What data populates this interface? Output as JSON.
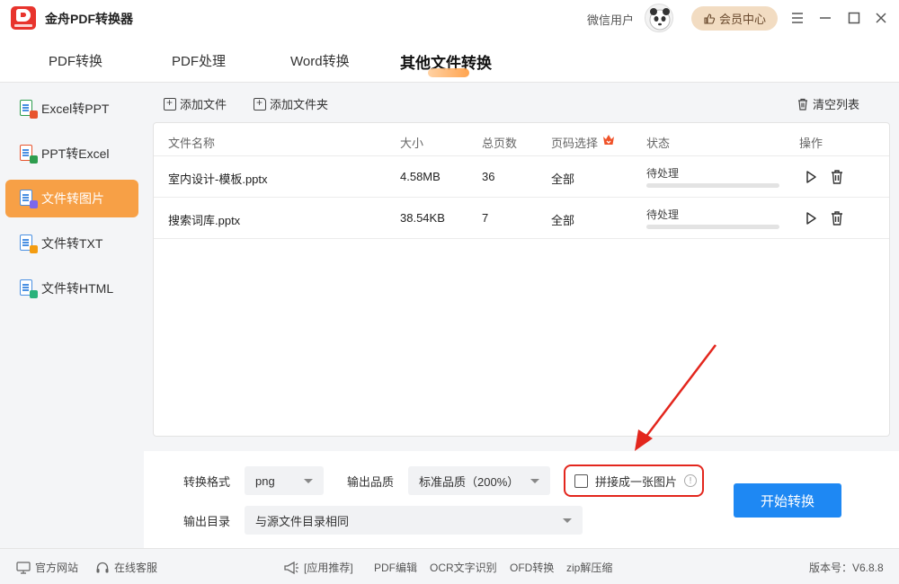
{
  "app": {
    "title": "金舟PDF转换器",
    "user_label": "微信用户",
    "vip_label": "会员中心"
  },
  "tabs": [
    {
      "label": "PDF转换",
      "active": false
    },
    {
      "label": "PDF处理",
      "active": false
    },
    {
      "label": "Word转换",
      "active": false
    },
    {
      "label": "其他文件转换",
      "active": true
    }
  ],
  "sidebar": {
    "items": [
      {
        "label": "Excel转PPT",
        "active": false,
        "badge_color": "#2e9d4e"
      },
      {
        "label": "PPT转Excel",
        "active": false,
        "badge_color": "#e8542d"
      },
      {
        "label": "文件转图片",
        "active": true,
        "badge_color": "#7b68ee"
      },
      {
        "label": "文件转TXT",
        "active": false,
        "badge_color": "#f39c12"
      },
      {
        "label": "文件转HTML",
        "active": false,
        "badge_color": "#2ab27b"
      }
    ]
  },
  "toolbar": {
    "add_file": "添加文件",
    "add_folder": "添加文件夹",
    "clear_list": "清空列表"
  },
  "table": {
    "headers": {
      "name": "文件名称",
      "size": "大小",
      "pages": "总页数",
      "page_select": "页码选择",
      "status": "状态",
      "actions": "操作"
    },
    "rows": [
      {
        "name": "室内设计-模板.pptx",
        "size": "4.58MB",
        "pages": "36",
        "page_select": "全部",
        "status": "待处理",
        "progress": 0
      },
      {
        "name": "搜索词库.pptx",
        "size": "38.54KB",
        "pages": "7",
        "page_select": "全部",
        "status": "待处理",
        "progress": 0
      }
    ]
  },
  "settings": {
    "format_label": "转换格式",
    "format_value": "png",
    "quality_label": "输出品质",
    "quality_value": "标准品质（200%）",
    "merge_label": "拼接成一张图片",
    "merge_checked": false,
    "output_label": "输出目录",
    "output_value": "与源文件目录相同",
    "start_label": "开始转换"
  },
  "footer": {
    "website": "官方网站",
    "service": "在线客服",
    "recommend": "[应用推荐]",
    "links": [
      "PDF编辑",
      "OCR文字识别",
      "OFD转换",
      "zip解压缩"
    ],
    "version": "版本号：V6.8.8"
  },
  "colors": {
    "accent_orange": "#f7a046",
    "primary_blue": "#1e88f3",
    "highlight_red": "#e3261d",
    "vip_bg": "#f2dcc2"
  }
}
